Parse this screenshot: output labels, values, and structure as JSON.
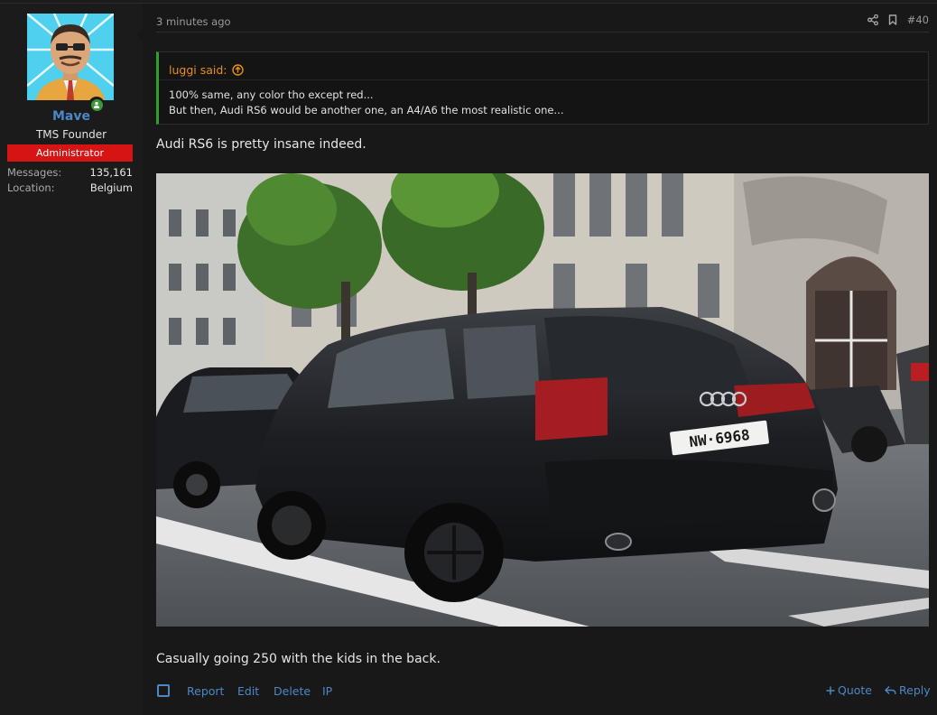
{
  "user": {
    "name": "Mave",
    "title": "TMS Founder",
    "banner": "Administrator",
    "stats": [
      {
        "label": "Messages:",
        "value": "135,161"
      },
      {
        "label": "Location:",
        "value": "Belgium"
      }
    ],
    "status": "online"
  },
  "post": {
    "time": "3 minutes ago",
    "number": "#40",
    "quote": {
      "author": "luggi said:",
      "lines": [
        "100% same, any color tho except red...",
        "But then, Audi RS6 would be another one, an A4/A6 the most realistic one..."
      ]
    },
    "message1": "Audi RS6 is pretty insane indeed.",
    "message2": "Casually going 250 with the kids in the back.",
    "photo": {
      "plate": "NW·6968"
    }
  },
  "actions": {
    "report": "Report",
    "edit": "Edit",
    "delete": "Delete",
    "ip": "IP",
    "quote": "Quote",
    "reply": "Reply"
  },
  "colors": {
    "link": "#4d87c7",
    "quote_author": "#e88f12",
    "quote_bar": "#2ea02e",
    "banner": "#d71414",
    "online": "#3a9a3a"
  }
}
